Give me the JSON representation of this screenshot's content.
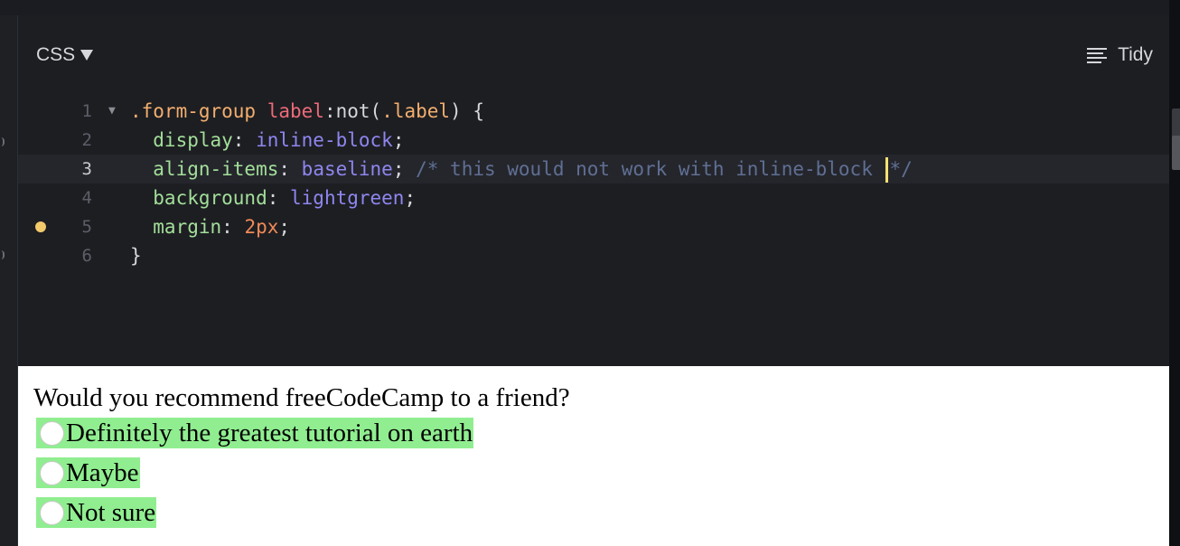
{
  "editor": {
    "language_label": "CSS",
    "tidy_label": "Tidy",
    "lines": [
      {
        "num": "1",
        "tokens": [
          {
            "t": ".form-group",
            "c": "t-sel"
          },
          {
            "t": " ",
            "c": "t-punc"
          },
          {
            "t": "label",
            "c": "t-tag"
          },
          {
            "t": ":not",
            "c": "t-pseudo"
          },
          {
            "t": "(",
            "c": "t-paren"
          },
          {
            "t": ".label",
            "c": "t-class"
          },
          {
            "t": ") {",
            "c": "t-punc"
          }
        ]
      },
      {
        "num": "2",
        "tokens": [
          {
            "t": "  display",
            "c": "t-prop"
          },
          {
            "t": ": ",
            "c": "t-punc"
          },
          {
            "t": "inline-block",
            "c": "t-val"
          },
          {
            "t": ";",
            "c": "t-punc"
          }
        ]
      },
      {
        "num": "3",
        "tokens": [
          {
            "t": "  align-items",
            "c": "t-prop"
          },
          {
            "t": ": ",
            "c": "t-punc"
          },
          {
            "t": "baseline",
            "c": "t-val"
          },
          {
            "t": "; ",
            "c": "t-punc"
          },
          {
            "t": "/* this would not work with inline-block ",
            "c": "t-comment"
          },
          {
            "t": "|",
            "c": "cursor"
          },
          {
            "t": "*/",
            "c": "t-comment"
          }
        ]
      },
      {
        "num": "4",
        "tokens": [
          {
            "t": "  background",
            "c": "t-prop"
          },
          {
            "t": ": ",
            "c": "t-punc"
          },
          {
            "t": "lightgreen",
            "c": "t-val"
          },
          {
            "t": ";",
            "c": "t-punc"
          }
        ]
      },
      {
        "num": "5",
        "tokens": [
          {
            "t": "  margin",
            "c": "t-prop"
          },
          {
            "t": ": ",
            "c": "t-punc"
          },
          {
            "t": "2px",
            "c": "t-num"
          },
          {
            "t": ";",
            "c": "t-punc"
          }
        ]
      },
      {
        "num": "6",
        "tokens": [
          {
            "t": "}",
            "c": "t-punc"
          }
        ]
      }
    ],
    "active_line": "3",
    "fold_line": "1",
    "marker_line": "5",
    "marker_color": "#f2c96b"
  },
  "preview": {
    "question": "Would you recommend freeCodeCamp to a friend?",
    "options": [
      {
        "label": "Definitely the greatest tutorial on earth"
      },
      {
        "label": "Maybe"
      },
      {
        "label": "Not sure"
      }
    ],
    "option_bg": "#90ee90"
  }
}
